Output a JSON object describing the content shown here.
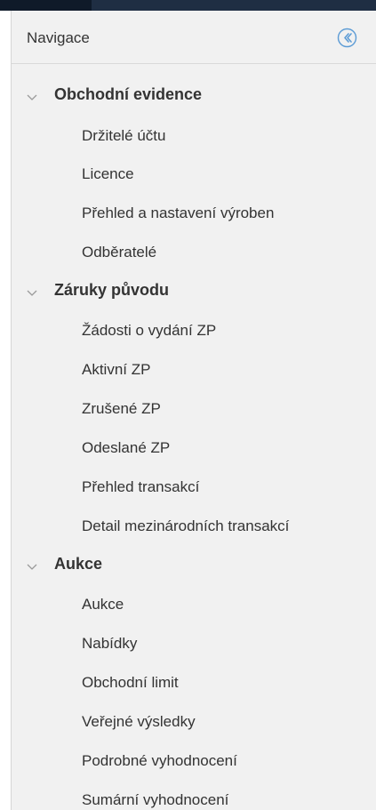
{
  "navigation": {
    "title": "Navigace",
    "collapse_icon": "chevron-left-circle-icon",
    "sections": [
      {
        "label": "Obchodní evidence",
        "items": [
          {
            "label": "Držitelé účtu"
          },
          {
            "label": "Licence"
          },
          {
            "label": "Přehled a nastavení výroben"
          },
          {
            "label": "Odběratelé"
          }
        ]
      },
      {
        "label": "Záruky původu",
        "items": [
          {
            "label": "Žádosti o vydání ZP"
          },
          {
            "label": "Aktivní ZP"
          },
          {
            "label": "Zrušené ZP"
          },
          {
            "label": "Odeslané ZP"
          },
          {
            "label": "Přehled transakcí"
          },
          {
            "label": "Detail mezinárodních transakcí"
          }
        ]
      },
      {
        "label": "Aukce",
        "items": [
          {
            "label": "Aukce"
          },
          {
            "label": "Nabídky"
          },
          {
            "label": "Obchodní limit"
          },
          {
            "label": "Veřejné výsledky"
          },
          {
            "label": "Podrobné vyhodnocení"
          },
          {
            "label": "Sumární vyhodnocení"
          }
        ]
      }
    ]
  },
  "colors": {
    "topbar": "#1f2e43",
    "panel_bg": "#f1f1f1",
    "text": "#333333",
    "accent": "#5b9bd5",
    "chevron": "#9a9a9a"
  }
}
